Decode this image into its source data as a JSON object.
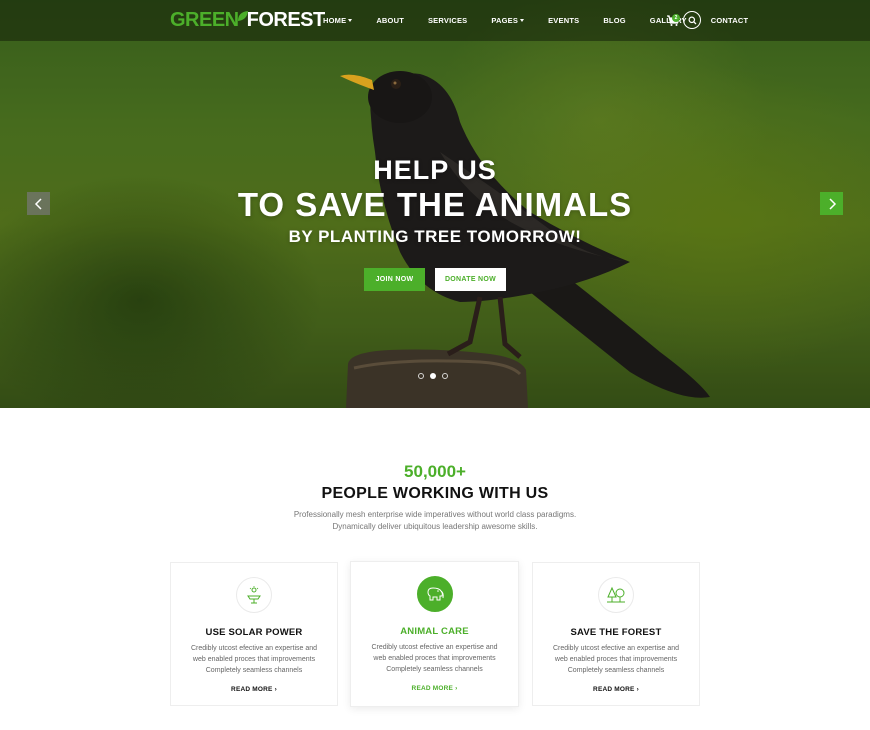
{
  "brand": {
    "logo_part1": "GREEN",
    "logo_part2": "FOREST",
    "accent": "#4caf2a"
  },
  "nav": {
    "items": [
      {
        "label": "HOME",
        "has_dropdown": true
      },
      {
        "label": "ABOUT",
        "has_dropdown": false
      },
      {
        "label": "SERVICES",
        "has_dropdown": false
      },
      {
        "label": "PAGES",
        "has_dropdown": true
      },
      {
        "label": "EVENTS",
        "has_dropdown": false
      },
      {
        "label": "BLOG",
        "has_dropdown": false
      },
      {
        "label": "GALLERY",
        "has_dropdown": false
      },
      {
        "label": "CONTACT",
        "has_dropdown": false
      }
    ],
    "cart_icon": "cart-icon",
    "cart_count": "2",
    "search_icon": "search-icon"
  },
  "hero": {
    "line1": "HELP US",
    "line2": "TO SAVE THE ANIMALS",
    "line3": "BY PLANTING TREE TOMORROW!",
    "join_label": "JOIN NOW",
    "donate_label": "DONATE NOW",
    "prev_icon": "chevron-left-icon",
    "next_icon": "chevron-right-icon",
    "slide_count": 3,
    "active_slide": 2
  },
  "stats": {
    "count": "50,000+",
    "title": "PEOPLE WORKING WITH US",
    "desc_line1": "Professionally mesh enterprise wide imperatives without world class paradigms.",
    "desc_line2": "Dynamically deliver ubiquitous leadership awesome skills."
  },
  "cards": [
    {
      "icon": "solar-panel-icon",
      "title": "USE SOLAR POWER",
      "line1": "Credibly utcost efective an expertise and",
      "line2": "web enabled proces that improvements",
      "line3": "Completely seamless channels",
      "link": "READ MORE ›"
    },
    {
      "icon": "elephant-icon",
      "title": "ANIMAL CARE",
      "line1": "Credibly utcost efective an expertise and",
      "line2": "web enabled proces that improvements",
      "line3": "Completely seamless channels",
      "link": "READ MORE ›"
    },
    {
      "icon": "trees-icon",
      "title": "SAVE THE FOREST",
      "line1": "Credibly utcost efective an expertise and",
      "line2": "web enabled proces that improvements",
      "line3": "Completely seamless channels",
      "link": "READ MORE ›"
    }
  ]
}
